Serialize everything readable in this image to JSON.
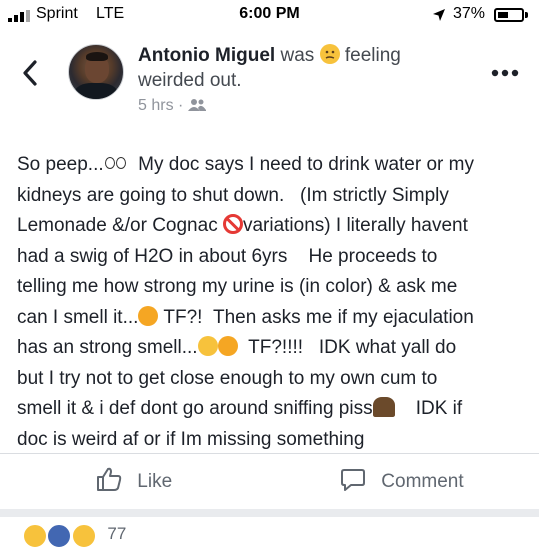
{
  "status_bar": {
    "carrier": "Sprint",
    "network": "LTE",
    "time": "6:00 PM",
    "battery_percent": "37%",
    "icons": [
      "signal-bars-icon",
      "location-arrow-icon",
      "battery-icon"
    ]
  },
  "header": {
    "back_icon": "chevron-left-icon",
    "author": "Antonio Miguel",
    "verb": "was",
    "feeling_emoji": "confused-face-emoji",
    "feeling_prefix": "feeling",
    "feeling_text": "weirded out.",
    "timestamp": "5 hrs",
    "separator": "·",
    "audience_icon": "friends-icon",
    "more_icon": "more-options-icon"
  },
  "post": {
    "lines": [
      {
        "parts": [
          {
            "text": "So peep..."
          },
          {
            "emoji": "eyes-emoji"
          },
          {
            "text": "  My doc says I need to drink water or my"
          }
        ]
      },
      {
        "parts": [
          {
            "text": "kidneys are going to shut down.   (Im strictly Simply"
          }
        ]
      },
      {
        "parts": [
          {
            "text": "Lemonade &/or Cognac "
          },
          {
            "emoji": "prohibited-emoji"
          },
          {
            "text": "variations) I literally havent"
          }
        ]
      },
      {
        "parts": [
          {
            "text": "had a swig of H2O in about 6yrs    He proceeds to"
          }
        ]
      },
      {
        "parts": [
          {
            "text": "telling me how strong my urine is (in color) & ask me"
          }
        ]
      },
      {
        "parts": [
          {
            "text": "can I smell it..."
          },
          {
            "emoji": "smirking-face-emoji"
          },
          {
            "text": " TF?!  Then asks me if my ejaculation"
          }
        ]
      },
      {
        "parts": [
          {
            "text": "has an strong smell..."
          },
          {
            "emoji": "flushed-face-emoji"
          },
          {
            "emoji": "grimacing-face-emoji"
          },
          {
            "text": "  TF?!!!!   IDK what yall do"
          }
        ]
      },
      {
        "parts": [
          {
            "text": "but I try not to get close enough to my own cum to"
          }
        ]
      },
      {
        "parts": [
          {
            "text": "smell it & i def dont go around sniffing piss"
          },
          {
            "emoji": "shrugging-person-emoji"
          },
          {
            "text": "    IDK if"
          }
        ]
      },
      {
        "parts": [
          {
            "text": "doc is weird af or if Im missing something"
          }
        ]
      }
    ]
  },
  "actions": {
    "like_label": "Like",
    "like_icon": "thumbs-up-icon",
    "comment_label": "Comment",
    "comment_icon": "comment-bubble-icon"
  },
  "reactions": {
    "icons": [
      "haha-reaction-icon",
      "like-reaction-icon",
      "wow-reaction-icon"
    ],
    "count": "77"
  }
}
